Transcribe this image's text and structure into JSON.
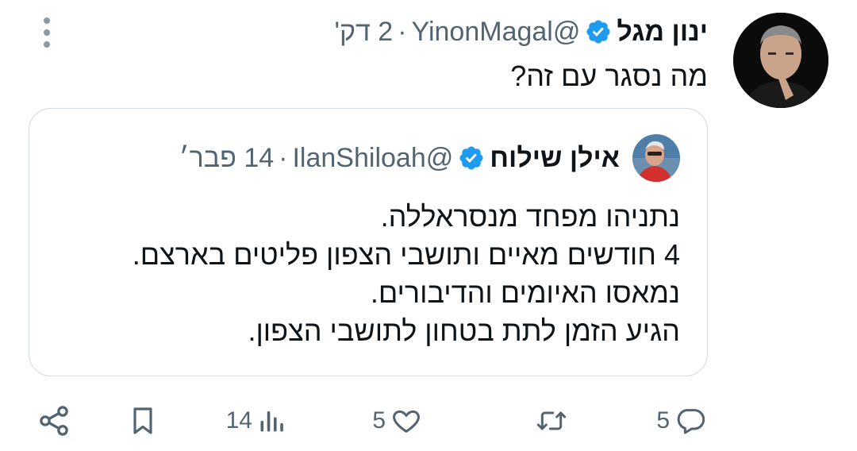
{
  "tweet": {
    "author_name": "ינון מגל",
    "handle": "@YinonMagal",
    "separator": "·",
    "time": "2 דק'",
    "text": "מה נסגר עם זה?"
  },
  "quoted": {
    "author_name": "אילן שילוח",
    "handle": "@IlanShiloah",
    "separator": "·",
    "time": "14 פבר׳",
    "lines": [
      "נתניהו מפחד מנסראללה.",
      "4 חודשים מאיים ותושבי הצפון פליטים בארצם.",
      "נמאסו האיומים והדיבורים.",
      "הגיע הזמן לתת בטחון לתושבי הצפון."
    ]
  },
  "actions": {
    "replies": "5",
    "retweets": "",
    "likes": "5",
    "views": "14"
  },
  "colors": {
    "verified": "#1d9bf0",
    "text": "#0f1419",
    "muted": "#536471",
    "border": "#cfd9de"
  },
  "icons": [
    "more-options-icon",
    "verified-badge-icon",
    "reply-icon",
    "retweet-icon",
    "like-icon",
    "views-icon",
    "bookmark-icon",
    "share-icon"
  ]
}
